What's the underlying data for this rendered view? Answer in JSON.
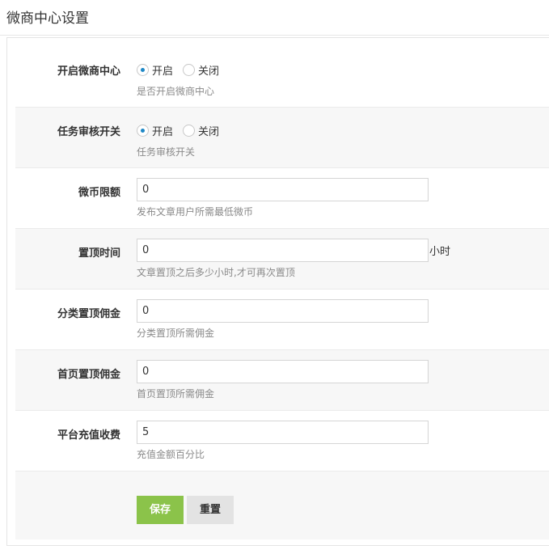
{
  "page": {
    "title": "微商中心设置"
  },
  "form": {
    "rows": [
      {
        "label": "开启微商中心",
        "type": "radio",
        "options": [
          "开启",
          "关闭"
        ],
        "selected": "开启",
        "help": "是否开启微商中心"
      },
      {
        "label": "任务审核开关",
        "type": "radio",
        "options": [
          "开启",
          "关闭"
        ],
        "selected": "开启",
        "help": "任务审核开关"
      },
      {
        "label": "微币限额",
        "type": "text",
        "value": "0",
        "help": "发布文章用户所需最低微币"
      },
      {
        "label": "置顶时间",
        "type": "text",
        "value": "0",
        "suffix": "小时",
        "help": "文章置顶之后多少小时,才可再次置顶"
      },
      {
        "label": "分类置顶佣金",
        "type": "text",
        "value": "0",
        "help": "分类置顶所需佣金"
      },
      {
        "label": "首页置顶佣金",
        "type": "text",
        "value": "0",
        "help": "首页置顶所需佣金"
      },
      {
        "label": "平台充值收费",
        "type": "text",
        "value": "5",
        "help": "充值金额百分比"
      }
    ],
    "buttons": {
      "save": "保存",
      "reset": "重置"
    }
  },
  "colors": {
    "accent": "#1e88c6",
    "save_button": "#8bc34a",
    "alt_row": "#f7f7f7"
  }
}
